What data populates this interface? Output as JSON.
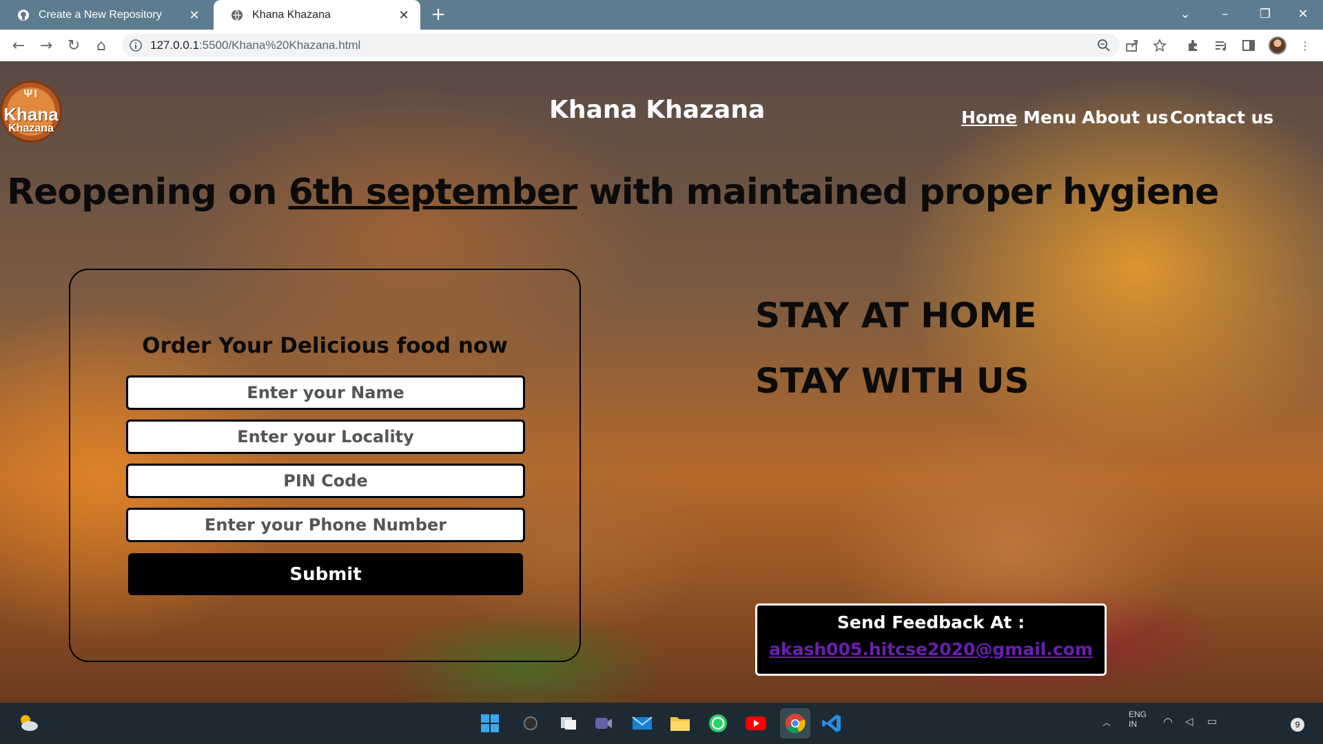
{
  "browser": {
    "tabs": [
      {
        "title": "Create a New Repository",
        "icon": "github-icon"
      },
      {
        "title": "Khana Khazana",
        "icon": "globe-icon"
      }
    ],
    "new_tab_label": "+",
    "url_host": "127.0.0.1",
    "url_path": ":5500/Khana%20Khazana.html"
  },
  "site": {
    "logo_line1": "Khana",
    "logo_line2": "Khazana",
    "title": "Khana Khazana",
    "nav": [
      {
        "label": "Home"
      },
      {
        "label": "Menu"
      },
      {
        "label": "About us"
      },
      {
        "label": "Contact us"
      }
    ],
    "headline_pre": "Reopening on ",
    "headline_date": "6th september",
    "headline_post": " with maintained proper hygiene"
  },
  "order_form": {
    "title": "Order Your Delicious food now",
    "name_placeholder": "Enter your Name",
    "locality_placeholder": "Enter your Locality",
    "pin_placeholder": "PIN Code",
    "phone_placeholder": "Enter your Phone Number",
    "submit_label": "Submit"
  },
  "stay": {
    "line1": "STAY AT HOME",
    "line2": "STAY WITH US"
  },
  "feedback": {
    "title": "Send Feedback At :",
    "email": "akash005.hitcse2020@gmail.com"
  },
  "taskbar": {
    "apps": [
      "windows-start-icon",
      "search-icon",
      "task-view-icon",
      "teams-icon",
      "mail-icon",
      "file-explorer-icon",
      "whatsapp-icon",
      "youtube-icon",
      "chrome-icon",
      "vscode-icon"
    ],
    "tray_lang": "ENG",
    "tray_region": "IN",
    "notification_count": "9"
  },
  "colors": {
    "tabbar": "#5e7c8f",
    "headline": "#0b0b0b",
    "email_link": "#6a1fb0"
  }
}
